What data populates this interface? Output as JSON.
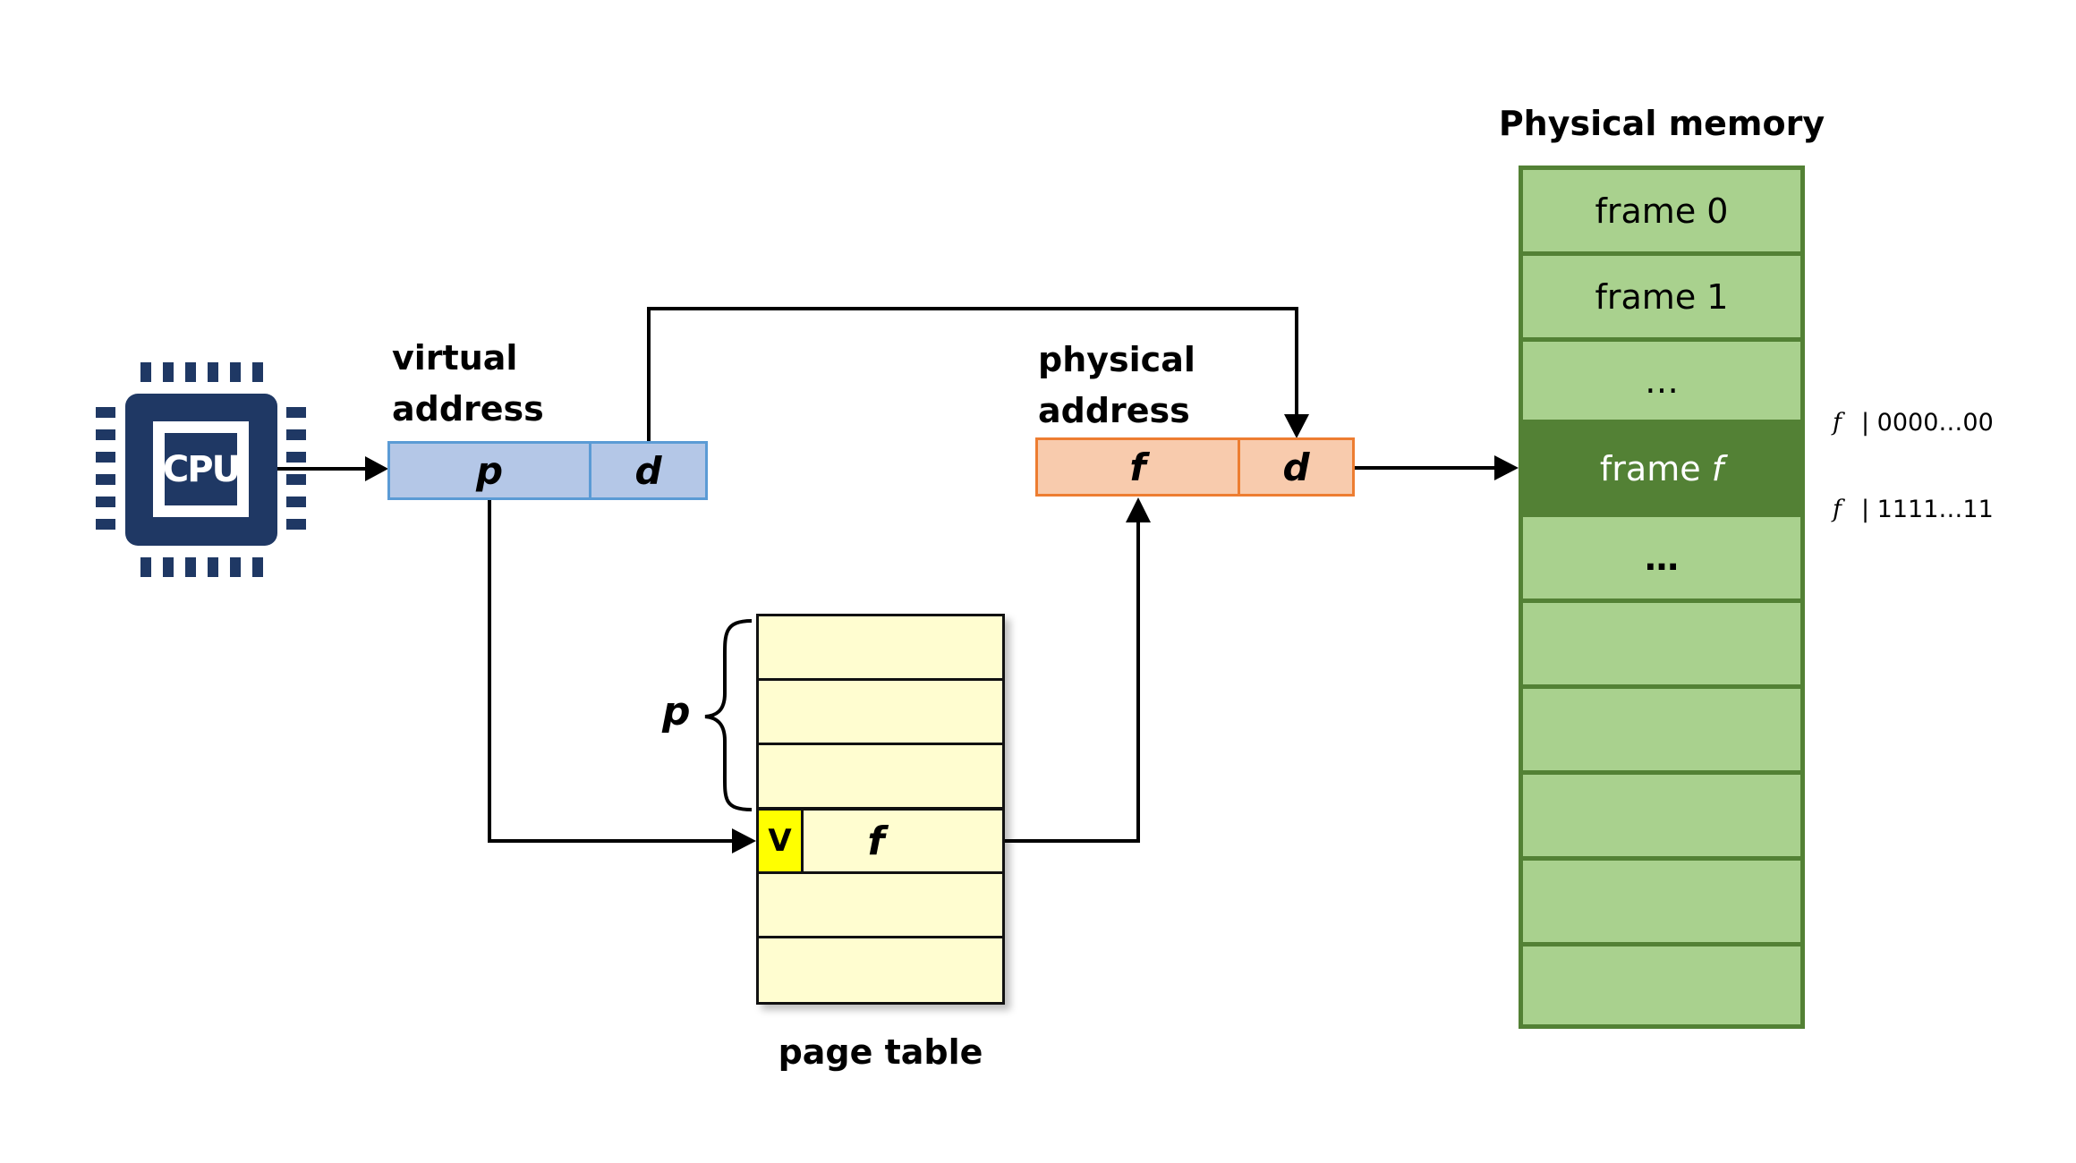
{
  "cpu": {
    "label": "CPU"
  },
  "virtual_address": {
    "label_line1": "virtual",
    "label_line2": "address",
    "fields": [
      "p",
      "d"
    ],
    "fill": "#b4c7e7",
    "border": "#5b9bd5"
  },
  "physical_address": {
    "label_line1": "physical",
    "label_line2": "address",
    "fields": [
      "f",
      "d"
    ],
    "fill": "#f8cbad",
    "border": "#ed7d31"
  },
  "page_table": {
    "label": "page table",
    "brace_label": "p",
    "entry_valid_bit": "V",
    "entry_frame": "f",
    "rows": 6,
    "highlighted_row": 4,
    "fill": "#fffdd0",
    "valid_fill": "#ffff00"
  },
  "physical_memory": {
    "title": "Physical memory",
    "frames": [
      "frame 0",
      "frame 1",
      "…",
      "frame f",
      "…",
      "",
      "",
      "",
      "",
      ""
    ],
    "highlighted_frame": 4,
    "fill": "#a9d18e",
    "highlight_fill": "#538135",
    "frame_start": {
      "var": "f",
      "offset": "| 0000…00"
    },
    "frame_end": {
      "var": "f",
      "offset": "| 1111…11"
    }
  }
}
